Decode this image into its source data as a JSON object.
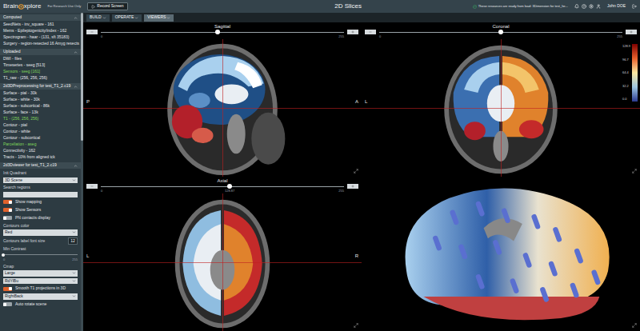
{
  "top_bar": {
    "logo_left": "Brain",
    "logo_right": "xplore",
    "tagline": "For Research Use Only",
    "record_button": "Record Screen",
    "title": "2D Slices",
    "notice": "These resources are ready from load: 3Dimension for test_he...",
    "user": "John DOE"
  },
  "menu": [
    {
      "label": "BUILD",
      "selected": false
    },
    {
      "label": "OPERATE",
      "selected": false
    },
    {
      "label": "VIEWERS",
      "selected": true
    }
  ],
  "sidebar": {
    "sections": [
      {
        "title": "Computed",
        "expanded": true,
        "items": [
          {
            "label": "SeedNets - inv_square - 161",
            "highlighted": false
          },
          {
            "label": "Mems - Epileptogenicity/index - 162",
            "highlighted": false
          },
          {
            "label": "Spectrogram - haar - (131, sft 35183)",
            "highlighted": false
          },
          {
            "label": "Surgery - region-resected 16 Amyg resects",
            "highlighted": false
          }
        ]
      },
      {
        "title": "Uploaded",
        "expanded": true,
        "items": [
          {
            "label": "DWI - files",
            "highlighted": false
          },
          {
            "label": "Timeseries - seeg [513]",
            "highlighted": false
          },
          {
            "label": "Sensors - seeg [161]",
            "highlighted": true
          },
          {
            "label": "T1_raw - (256, 256, 256)",
            "highlighted": false
          }
        ]
      },
      {
        "title": "2d3DPreprocessing for test_T1_2.c19",
        "expanded": true,
        "items": [
          {
            "label": "Surface - pial - 30k",
            "highlighted": false
          },
          {
            "label": "Surface - white - 30k",
            "highlighted": false
          },
          {
            "label": "Surface - subcortical - 86k",
            "highlighted": false
          },
          {
            "label": "Surface - face - 13k",
            "highlighted": false
          },
          {
            "label": "T1 - (256, 256, 256)",
            "highlighted": true
          },
          {
            "label": "Contour - pial",
            "highlighted": false
          },
          {
            "label": "Contour - white",
            "highlighted": false
          },
          {
            "label": "Contour - subcortical",
            "highlighted": false
          },
          {
            "label": "Parcellation - aseg",
            "highlighted": true
          },
          {
            "label": "Connectivity - 162",
            "highlighted": false
          },
          {
            "label": "Tracts - 10% from aligned tck",
            "highlighted": false
          }
        ]
      }
    ],
    "viewer": {
      "title": "2d3Dviewer for test_T1_2.c19",
      "expanded": true,
      "controls": [
        {
          "kind": "select",
          "label": "Init Quadrant",
          "value": "3D Scene"
        },
        {
          "kind": "input",
          "label": "Search regions",
          "value": ""
        },
        {
          "kind": "toggle",
          "label": "Show mapping",
          "on": true
        },
        {
          "kind": "toggle",
          "label": "Show Sensors",
          "on": true
        },
        {
          "kind": "toggle",
          "label": "PN contacts display",
          "on": false
        },
        {
          "kind": "select",
          "label": "Contours color",
          "value": "Red"
        },
        {
          "kind": "number",
          "label": "Contours label font size",
          "value": "12"
        },
        {
          "kind": "slider",
          "label": "Min Contrast",
          "level": 0,
          "min": "0",
          "max": "255"
        },
        {
          "kind": "select",
          "label": "Cmap",
          "value": "Large"
        },
        {
          "kind": "select",
          "value": "RdYlBu"
        },
        {
          "kind": "toggle",
          "label": "Smooth T1 projections in 3D",
          "on": true
        },
        {
          "kind": "select",
          "value": "RightBack"
        },
        {
          "kind": "toggle",
          "label": "Auto rotate scene",
          "on": false
        }
      ]
    }
  },
  "panels": [
    {
      "kind": "sagittal",
      "title": "Sagittal",
      "level": 0.48,
      "min": "0",
      "max": "255",
      "left_label": "P",
      "right_label": "A"
    },
    {
      "kind": "coronal",
      "title": "Coronal",
      "level": 0.5,
      "min": "0",
      "max": "255",
      "left_label": "L",
      "colorbar": [
        "128.9",
        "96.7",
        "64.4",
        "32.2",
        "0.0"
      ]
    },
    {
      "kind": "axial",
      "title": "Axial",
      "level": 0.53,
      "min": "0",
      "max": "255",
      "value": "128.87",
      "left_label": "L",
      "right_label": "R"
    },
    {
      "kind": "3d"
    }
  ]
}
